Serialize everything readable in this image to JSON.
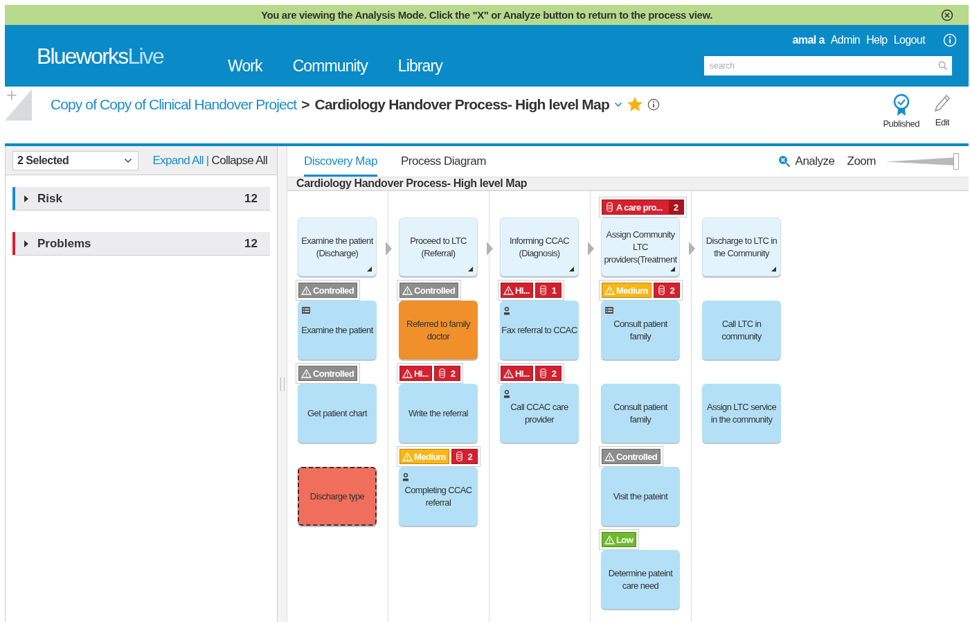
{
  "banner": {
    "message": "You are viewing the Analysis Mode. Click the \"X\" or Analyze button to return to the process view."
  },
  "header": {
    "logo_bold": "Blueworks",
    "logo_light": "Live",
    "nav": [
      {
        "label": "Work"
      },
      {
        "label": "Community"
      },
      {
        "label": "Library"
      }
    ],
    "user_links": [
      "amal a",
      "Admin",
      "Help",
      "Logout"
    ],
    "search": {
      "placeholder": "search"
    }
  },
  "breadcrumb": {
    "parent": "Copy of Copy of Clinical Handover Project",
    "separator": ">",
    "current": "Cardiology Handover Process- High level Map",
    "favorite": true
  },
  "actions": [
    {
      "kind": "published",
      "label": "Published"
    },
    {
      "kind": "edit",
      "label": "Edit"
    }
  ],
  "sidebar": {
    "filter": "2 Selected",
    "expand": "Expand All",
    "divider": "|",
    "collapse": "Collapse All",
    "groups": [
      {
        "label": "Risk",
        "count": "12",
        "color": "#1a8ccc",
        "expanded": false
      },
      {
        "label": "Problems",
        "count": "12",
        "color": "#d9202e",
        "expanded": false
      }
    ]
  },
  "tabs": [
    {
      "label": "Discovery Map",
      "selected": true
    },
    {
      "label": "Process Diagram",
      "selected": false
    }
  ],
  "toolbar": {
    "analyze": "Analyze",
    "zoom_label": "Zoom",
    "zoom": {
      "level": 1
    }
  },
  "map": {
    "title": "Cardiology Handover Process- High level Map",
    "columns": [
      {
        "cards": [
          {
            "kind": "milestone",
            "text": "Examine the patient (Discharge)"
          },
          {
            "kind": "activity",
            "text": "Examine the patient",
            "marker": {
              "kind": "list"
            },
            "badges": [
              {
                "kind": "risk",
                "color": "#8e8e8e",
                "label": "Controlled"
              }
            ]
          },
          {
            "kind": "activity",
            "text": "Get patient chart",
            "badges": [
              {
                "kind": "risk",
                "color": "#8e8e8e",
                "label": "Controlled"
              }
            ]
          },
          {
            "kind": "decision",
            "text": "Discharge type"
          }
        ]
      },
      {
        "cards": [
          {
            "kind": "milestone",
            "text": "Proceed to LTC (Referral)"
          },
          {
            "kind": "highlighted",
            "text": "Referred to family doctor",
            "badges": [
              {
                "kind": "risk",
                "color": "#8e8e8e",
                "label": "Controlled"
              }
            ]
          },
          {
            "kind": "activity",
            "text": "Write the referral",
            "badges": [
              {
                "kind": "risk",
                "color": "#d5202f",
                "label": "HI..."
              },
              {
                "kind": "problem",
                "count": "2"
              }
            ]
          },
          {
            "kind": "activity",
            "text": "Completing CCAC referral",
            "marker": {
              "kind": "person"
            },
            "badges": [
              {
                "kind": "risk",
                "color": "#f8b617",
                "label": "Medium"
              },
              {
                "kind": "problem",
                "count": "2"
              }
            ]
          }
        ]
      },
      {
        "cards": [
          {
            "kind": "milestone",
            "text": "Informing CCAC (Diagnosis)"
          },
          {
            "kind": "activity",
            "text": "Fax referral to CCAC",
            "marker": {
              "kind": "person"
            },
            "badges": [
              {
                "kind": "risk",
                "color": "#d5202f",
                "label": "HI..."
              },
              {
                "kind": "problem",
                "count": "1"
              }
            ]
          },
          {
            "kind": "activity",
            "text": "Call CCAC care provider",
            "marker": {
              "kind": "person"
            },
            "badges": [
              {
                "kind": "risk",
                "color": "#d5202f",
                "label": "HI..."
              },
              {
                "kind": "problem",
                "count": "2"
              }
            ]
          }
        ]
      },
      {
        "cards": [
          {
            "kind": "milestone",
            "text": "Assign Community LTC providers(Treatment",
            "badges": [
              {
                "kind": "problem",
                "label": "A care pro...",
                "count": "2"
              }
            ]
          },
          {
            "kind": "activity",
            "text": "Consult patient family",
            "marker": {
              "kind": "list"
            },
            "badges": [
              {
                "kind": "risk",
                "color": "#f8b617",
                "label": "Medium"
              },
              {
                "kind": "problem",
                "count": "2"
              }
            ]
          },
          {
            "kind": "activity",
            "text": "Consult patient family"
          },
          {
            "kind": "activity",
            "text": "Visit the pateint",
            "badges": [
              {
                "kind": "risk",
                "color": "#8e8e8e",
                "label": "Controlled"
              }
            ]
          },
          {
            "kind": "activity",
            "text": "Determine pateint care need",
            "badges": [
              {
                "kind": "risk",
                "color": "#6fb92c",
                "label": "Low"
              }
            ]
          }
        ]
      },
      {
        "cards": [
          {
            "kind": "milestone",
            "text": "Discharge to LTC in the Community"
          },
          {
            "kind": "activity",
            "text": "Call LTC in community"
          },
          {
            "kind": "activity",
            "text": "Assign LTC service in the community"
          }
        ]
      }
    ]
  }
}
